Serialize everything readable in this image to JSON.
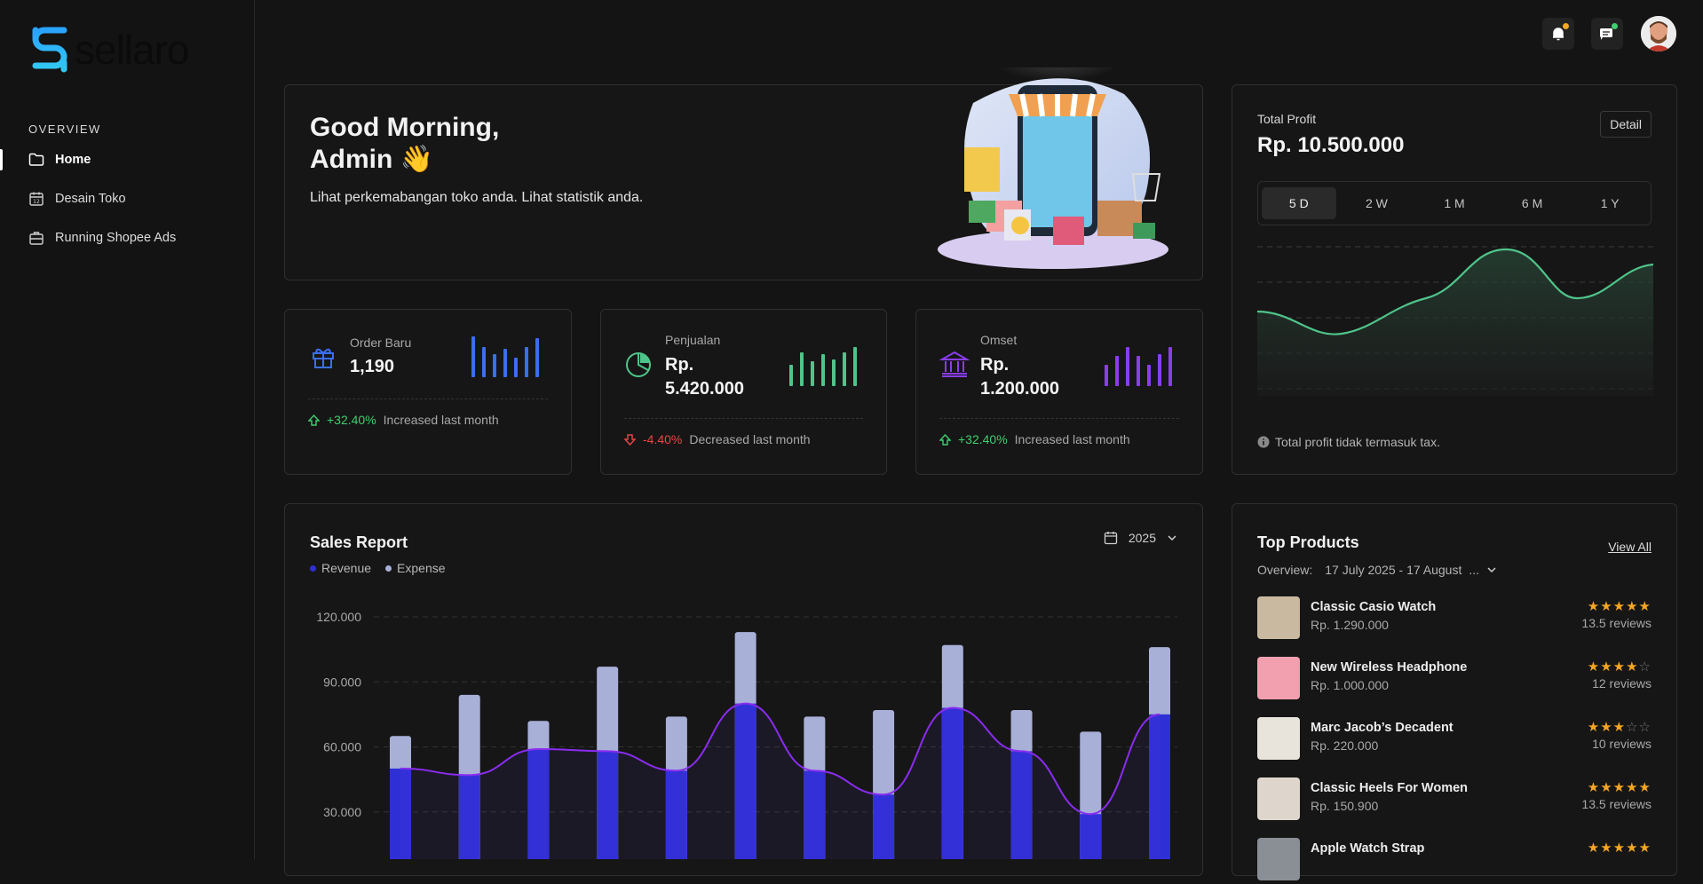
{
  "brand": {
    "name": "sellaro"
  },
  "sidebar": {
    "section_title": "OVERVIEW",
    "items": [
      {
        "label": "Home",
        "icon": "folder-icon",
        "active": true
      },
      {
        "label": "Desain Toko",
        "icon": "calendar-icon",
        "active": false
      },
      {
        "label": "Running Shopee Ads",
        "icon": "briefcase-icon",
        "active": false
      }
    ]
  },
  "topbar": {
    "notification_icon": "bell-icon",
    "message_icon": "chat-icon",
    "notification_dot_color": "#f5a623",
    "message_dot_color": "#3ecf6e"
  },
  "greeting": {
    "line1": "Good Morning,",
    "line2": "Admin 👋",
    "subtitle": "Lihat perkemabangan toko anda. Lihat statistik anda."
  },
  "stats": [
    {
      "label": "Order Baru",
      "value": "1,190",
      "change": "+32.40%",
      "trend": "up",
      "note": "Increased last month",
      "icon": "gift-icon",
      "color": "#3d6df2"
    },
    {
      "label": "Penjualan",
      "value": "Rp. 5.420.000",
      "change": "-4.40%",
      "trend": "down",
      "note": "Decreased last month",
      "icon": "pie-chart-icon",
      "color": "#4fc48a"
    },
    {
      "label": "Omset",
      "value": "Rp. 1.200.000",
      "change": "+32.40%",
      "trend": "up",
      "note": "Increased last month",
      "icon": "bank-icon",
      "color": "#8a3df0"
    }
  ],
  "profit": {
    "label": "Total Profit",
    "value": "Rp. 10.500.000",
    "detail_label": "Detail",
    "tabs": [
      "5 D",
      "2 W",
      "1 M",
      "6 M",
      "1 Y"
    ],
    "active_tab": "5 D",
    "note": "Total profit tidak termasuk tax.",
    "line_color": "#4fc48a"
  },
  "sales_report": {
    "title": "Sales Report",
    "year": "2025",
    "legend": [
      {
        "name": "Revenue",
        "color": "#2f2fd6"
      },
      {
        "name": "Expense",
        "color": "#a8b0d8"
      }
    ]
  },
  "chart_data": {
    "type": "bar",
    "ylim": [
      0,
      120000
    ],
    "ytick_labels": [
      "120.000",
      "90.000",
      "60.000",
      "30.000"
    ],
    "ytick_values": [
      120000,
      90000,
      60000,
      30000
    ],
    "series": [
      {
        "name": "Revenue",
        "values": [
          50000,
          47000,
          59000,
          58000,
          49000,
          80000,
          49000,
          38000,
          78000,
          58000,
          29000,
          75000
        ]
      },
      {
        "name": "Expense",
        "values": [
          65000,
          84000,
          72000,
          97000,
          74000,
          113000,
          74000,
          77000,
          107000,
          77000,
          67000,
          106000
        ]
      }
    ],
    "grid": true
  },
  "top_products": {
    "title": "Top Products",
    "view_all": "View All",
    "overview_label": "Overview:",
    "overview_range": "17 July 2025 - 17 August",
    "overview_more": "...",
    "items": [
      {
        "name": "Classic Casio Watch",
        "price": "Rp. 1.290.000",
        "rating": 5,
        "reviews": "13.5 reviews",
        "thumb_color": "#c9b9a0"
      },
      {
        "name": "New Wireless Headphone",
        "price": "Rp. 1.000.000",
        "rating": 4,
        "reviews": "12 reviews",
        "thumb_color": "#f2a0b0"
      },
      {
        "name": "Marc Jacob’s Decadent",
        "price": "Rp. 220.000",
        "rating": 3,
        "reviews": "10 reviews",
        "thumb_color": "#e8e4dc"
      },
      {
        "name": "Classic Heels For Women",
        "price": "Rp. 150.900",
        "rating": 5,
        "reviews": "13.5 reviews",
        "thumb_color": "#ded6cc"
      },
      {
        "name": "Apple Watch Strap",
        "price": "",
        "rating": 5,
        "reviews": "",
        "thumb_color": "#8a8f96"
      }
    ]
  }
}
